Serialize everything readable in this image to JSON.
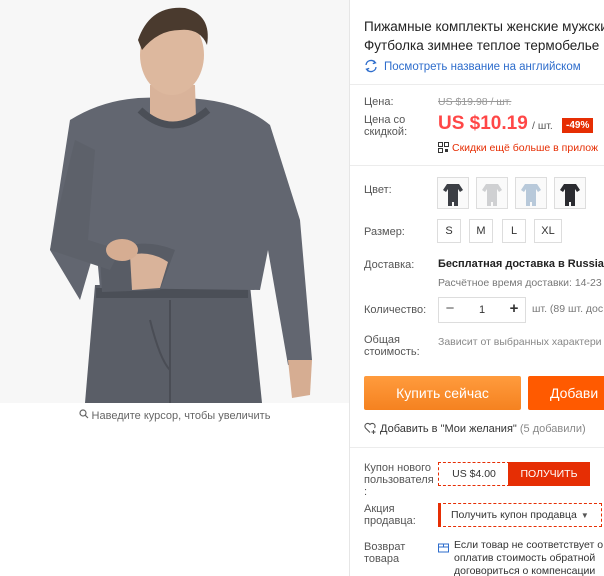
{
  "product": {
    "title_line1": "Пижамные комплекты женские мужские",
    "title_line2": "Футболка зимнее теплое термобелье",
    "translate_link": "Посмотреть название на английском"
  },
  "gallery": {
    "zoom_hint": "Наведите курсор, чтобы увеличить"
  },
  "pricing": {
    "price_label": "Цена:",
    "discount_price_label_l1": "Цена со",
    "discount_price_label_l2": "скидкой:",
    "original_price": "US $19.98 / шт.",
    "current_price": "US $10.19",
    "per_unit": "/ шт.",
    "discount_badge": "-49%",
    "app_discount": "Скидки ещё больше в прилож"
  },
  "color": {
    "label": "Цвет:",
    "swatches": [
      {
        "name": "dark-grey",
        "color": "#3c3f45"
      },
      {
        "name": "light-grey",
        "color": "#cfd0d2"
      },
      {
        "name": "light-blue",
        "color": "#b8c9da"
      },
      {
        "name": "black",
        "color": "#2a2b30"
      }
    ]
  },
  "size": {
    "label": "Размер:",
    "options": [
      "S",
      "M",
      "L",
      "XL"
    ]
  },
  "shipping": {
    "label": "Доставка:",
    "value": "Бесплатная доставка в Russian",
    "time": "Расчётное время доставки: 14-23"
  },
  "quantity": {
    "label": "Количество:",
    "minus": "−",
    "value": "1",
    "plus": "+",
    "available": "шт. (89 шт. дос"
  },
  "total": {
    "label_l1": "Общая",
    "label_l2": "стоимость:",
    "value": "Зависит от выбранных характери"
  },
  "actions": {
    "buy_now": "Купить сейчас",
    "add_to_cart": "Добави"
  },
  "wishlist": {
    "label": "Добавить в \"Мои желания\"",
    "count": "(5 добавили)"
  },
  "coupon": {
    "label_l1": "Купон нового",
    "label_l2": "пользователя",
    "label_l3": ":",
    "amount": "US $4.00",
    "button": "ПОЛУЧИТЬ"
  },
  "seller_promo": {
    "label_l1": "Акция",
    "label_l2": "продавца:",
    "select_value": "Получить купон продавца"
  },
  "returns": {
    "label_l1": "Возврат",
    "label_l2": "товара",
    "text_l1": "Если товар не соответствует о",
    "text_l2": "оплатив стоимость обратной",
    "text_l3": "договориться о компенсации"
  },
  "colors": {
    "accent_red": "#ff4747",
    "buy_orange": "#f58220",
    "cart_orange": "#ff5a00",
    "link_blue": "#2e6dcc"
  }
}
